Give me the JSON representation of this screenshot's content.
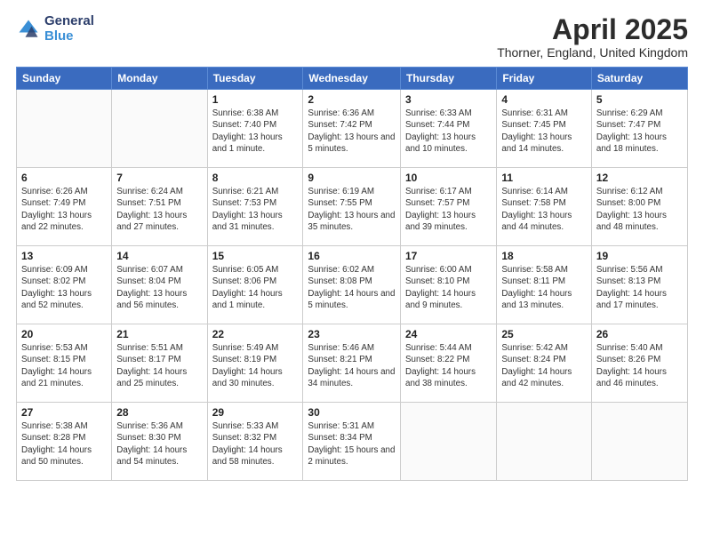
{
  "logo": {
    "general": "General",
    "blue": "Blue"
  },
  "title": {
    "month": "April 2025",
    "location": "Thorner, England, United Kingdom"
  },
  "weekdays": [
    "Sunday",
    "Monday",
    "Tuesday",
    "Wednesday",
    "Thursday",
    "Friday",
    "Saturday"
  ],
  "weeks": [
    [
      {
        "day": null
      },
      {
        "day": null
      },
      {
        "day": "1",
        "sunrise": "Sunrise: 6:38 AM",
        "sunset": "Sunset: 7:40 PM",
        "daylight": "Daylight: 13 hours and 1 minute."
      },
      {
        "day": "2",
        "sunrise": "Sunrise: 6:36 AM",
        "sunset": "Sunset: 7:42 PM",
        "daylight": "Daylight: 13 hours and 5 minutes."
      },
      {
        "day": "3",
        "sunrise": "Sunrise: 6:33 AM",
        "sunset": "Sunset: 7:44 PM",
        "daylight": "Daylight: 13 hours and 10 minutes."
      },
      {
        "day": "4",
        "sunrise": "Sunrise: 6:31 AM",
        "sunset": "Sunset: 7:45 PM",
        "daylight": "Daylight: 13 hours and 14 minutes."
      },
      {
        "day": "5",
        "sunrise": "Sunrise: 6:29 AM",
        "sunset": "Sunset: 7:47 PM",
        "daylight": "Daylight: 13 hours and 18 minutes."
      }
    ],
    [
      {
        "day": "6",
        "sunrise": "Sunrise: 6:26 AM",
        "sunset": "Sunset: 7:49 PM",
        "daylight": "Daylight: 13 hours and 22 minutes."
      },
      {
        "day": "7",
        "sunrise": "Sunrise: 6:24 AM",
        "sunset": "Sunset: 7:51 PM",
        "daylight": "Daylight: 13 hours and 27 minutes."
      },
      {
        "day": "8",
        "sunrise": "Sunrise: 6:21 AM",
        "sunset": "Sunset: 7:53 PM",
        "daylight": "Daylight: 13 hours and 31 minutes."
      },
      {
        "day": "9",
        "sunrise": "Sunrise: 6:19 AM",
        "sunset": "Sunset: 7:55 PM",
        "daylight": "Daylight: 13 hours and 35 minutes."
      },
      {
        "day": "10",
        "sunrise": "Sunrise: 6:17 AM",
        "sunset": "Sunset: 7:57 PM",
        "daylight": "Daylight: 13 hours and 39 minutes."
      },
      {
        "day": "11",
        "sunrise": "Sunrise: 6:14 AM",
        "sunset": "Sunset: 7:58 PM",
        "daylight": "Daylight: 13 hours and 44 minutes."
      },
      {
        "day": "12",
        "sunrise": "Sunrise: 6:12 AM",
        "sunset": "Sunset: 8:00 PM",
        "daylight": "Daylight: 13 hours and 48 minutes."
      }
    ],
    [
      {
        "day": "13",
        "sunrise": "Sunrise: 6:09 AM",
        "sunset": "Sunset: 8:02 PM",
        "daylight": "Daylight: 13 hours and 52 minutes."
      },
      {
        "day": "14",
        "sunrise": "Sunrise: 6:07 AM",
        "sunset": "Sunset: 8:04 PM",
        "daylight": "Daylight: 13 hours and 56 minutes."
      },
      {
        "day": "15",
        "sunrise": "Sunrise: 6:05 AM",
        "sunset": "Sunset: 8:06 PM",
        "daylight": "Daylight: 14 hours and 1 minute."
      },
      {
        "day": "16",
        "sunrise": "Sunrise: 6:02 AM",
        "sunset": "Sunset: 8:08 PM",
        "daylight": "Daylight: 14 hours and 5 minutes."
      },
      {
        "day": "17",
        "sunrise": "Sunrise: 6:00 AM",
        "sunset": "Sunset: 8:10 PM",
        "daylight": "Daylight: 14 hours and 9 minutes."
      },
      {
        "day": "18",
        "sunrise": "Sunrise: 5:58 AM",
        "sunset": "Sunset: 8:11 PM",
        "daylight": "Daylight: 14 hours and 13 minutes."
      },
      {
        "day": "19",
        "sunrise": "Sunrise: 5:56 AM",
        "sunset": "Sunset: 8:13 PM",
        "daylight": "Daylight: 14 hours and 17 minutes."
      }
    ],
    [
      {
        "day": "20",
        "sunrise": "Sunrise: 5:53 AM",
        "sunset": "Sunset: 8:15 PM",
        "daylight": "Daylight: 14 hours and 21 minutes."
      },
      {
        "day": "21",
        "sunrise": "Sunrise: 5:51 AM",
        "sunset": "Sunset: 8:17 PM",
        "daylight": "Daylight: 14 hours and 25 minutes."
      },
      {
        "day": "22",
        "sunrise": "Sunrise: 5:49 AM",
        "sunset": "Sunset: 8:19 PM",
        "daylight": "Daylight: 14 hours and 30 minutes."
      },
      {
        "day": "23",
        "sunrise": "Sunrise: 5:46 AM",
        "sunset": "Sunset: 8:21 PM",
        "daylight": "Daylight: 14 hours and 34 minutes."
      },
      {
        "day": "24",
        "sunrise": "Sunrise: 5:44 AM",
        "sunset": "Sunset: 8:22 PM",
        "daylight": "Daylight: 14 hours and 38 minutes."
      },
      {
        "day": "25",
        "sunrise": "Sunrise: 5:42 AM",
        "sunset": "Sunset: 8:24 PM",
        "daylight": "Daylight: 14 hours and 42 minutes."
      },
      {
        "day": "26",
        "sunrise": "Sunrise: 5:40 AM",
        "sunset": "Sunset: 8:26 PM",
        "daylight": "Daylight: 14 hours and 46 minutes."
      }
    ],
    [
      {
        "day": "27",
        "sunrise": "Sunrise: 5:38 AM",
        "sunset": "Sunset: 8:28 PM",
        "daylight": "Daylight: 14 hours and 50 minutes."
      },
      {
        "day": "28",
        "sunrise": "Sunrise: 5:36 AM",
        "sunset": "Sunset: 8:30 PM",
        "daylight": "Daylight: 14 hours and 54 minutes."
      },
      {
        "day": "29",
        "sunrise": "Sunrise: 5:33 AM",
        "sunset": "Sunset: 8:32 PM",
        "daylight": "Daylight: 14 hours and 58 minutes."
      },
      {
        "day": "30",
        "sunrise": "Sunrise: 5:31 AM",
        "sunset": "Sunset: 8:34 PM",
        "daylight": "Daylight: 15 hours and 2 minutes."
      },
      {
        "day": null
      },
      {
        "day": null
      },
      {
        "day": null
      }
    ]
  ]
}
